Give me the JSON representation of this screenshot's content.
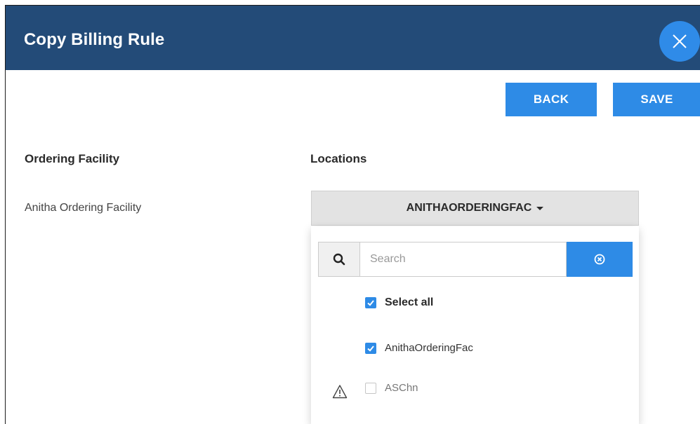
{
  "dialog": {
    "title": "Copy Billing Rule"
  },
  "toolbar": {
    "back_label": "BACK",
    "save_label": "SAVE"
  },
  "form": {
    "ordering_facility_label": "Ordering Facility",
    "ordering_facility_value": "Anitha Ordering Facility",
    "locations_label": "Locations",
    "locations_selected": "ANITHAORDERINGFAC"
  },
  "locations_menu": {
    "search_placeholder": "Search",
    "search_value": "",
    "options": [
      {
        "label": "Select all",
        "checked": true
      },
      {
        "label": "AnithaOrderingFac",
        "checked": true
      },
      {
        "label": "ASChn",
        "checked": false,
        "warning": true
      }
    ]
  },
  "icons": {
    "close": "close-icon",
    "search": "search-icon",
    "clear": "clear-circle-icon",
    "caret": "caret-down-icon",
    "warning": "warning-icon",
    "check": "check-icon"
  },
  "colors": {
    "header_bg": "#234b78",
    "accent": "#2e8be6",
    "dropdown_bg": "#e3e3e3"
  }
}
